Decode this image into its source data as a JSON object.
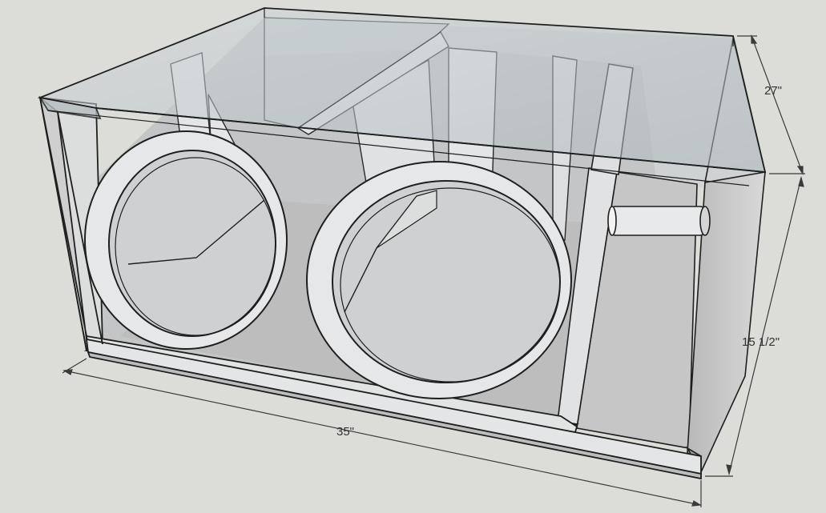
{
  "model": {
    "colors": {
      "background": "#dcdcd9",
      "panel_face": "#e6e7e8",
      "panel_shade": "#c9cacb",
      "interior_floor": "#bdbdbd",
      "glass": "#b8c2c6",
      "edge": "#1f1f1f"
    },
    "parts": [
      "front-baffle",
      "left-woofer-cutout",
      "right-woofer-cutout",
      "port-chamber",
      "port-tube",
      "top-panel",
      "right-side-panel"
    ]
  },
  "dimensions": {
    "width_label": "35\"",
    "depth_label": "27\"",
    "height_label": "15 1/2\""
  }
}
